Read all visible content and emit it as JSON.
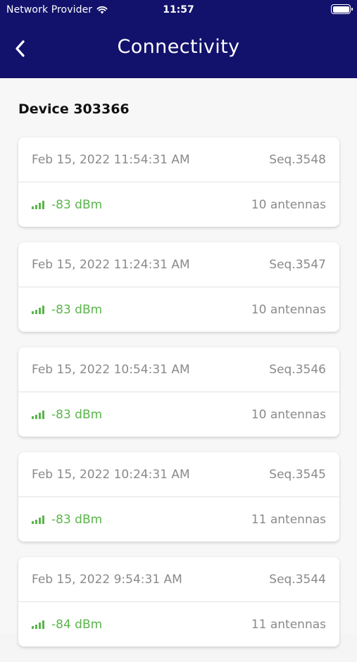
{
  "status_bar": {
    "carrier": "Network Provider",
    "time": "11:57"
  },
  "header": {
    "title": "Connectivity",
    "back_icon": "chevron-left-icon"
  },
  "device_title": "Device 303366",
  "colors": {
    "header_bg": "#12126c",
    "signal_green": "#5ab54b",
    "muted_text": "#8a8a8a"
  },
  "records": [
    {
      "timestamp": "Feb 15, 2022 11:54:31 AM",
      "seq": "Seq.3548",
      "signal": "-83 dBm",
      "antennas": "10 antennas"
    },
    {
      "timestamp": "Feb 15, 2022 11:24:31 AM",
      "seq": "Seq.3547",
      "signal": "-83 dBm",
      "antennas": "10 antennas"
    },
    {
      "timestamp": "Feb 15, 2022 10:54:31 AM",
      "seq": "Seq.3546",
      "signal": "-83 dBm",
      "antennas": "10 antennas"
    },
    {
      "timestamp": "Feb 15, 2022 10:24:31 AM",
      "seq": "Seq.3545",
      "signal": "-83 dBm",
      "antennas": "11 antennas"
    },
    {
      "timestamp": "Feb 15, 2022 9:54:31 AM",
      "seq": "Seq.3544",
      "signal": "-84 dBm",
      "antennas": "11 antennas"
    }
  ]
}
